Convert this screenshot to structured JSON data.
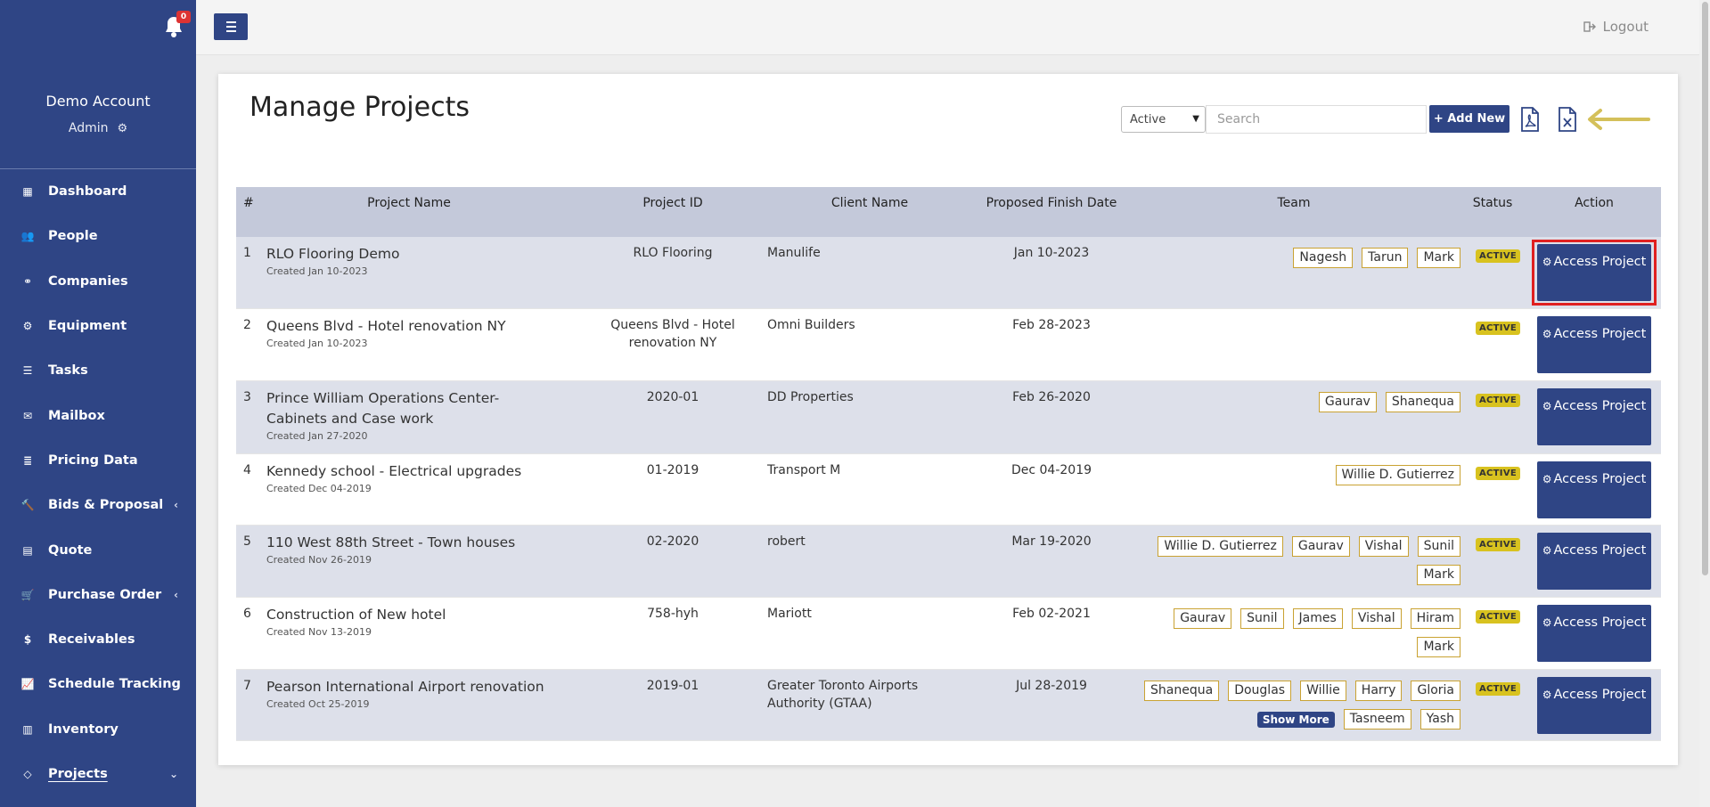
{
  "sidebar": {
    "notifications": {
      "count": "0",
      "icon": "bell-icon"
    },
    "account": {
      "name": "Demo Account",
      "role": "Admin"
    },
    "items": [
      {
        "label": "Dashboard",
        "icon": "grid-icon"
      },
      {
        "label": "People",
        "icon": "users-icon"
      },
      {
        "label": "Companies",
        "icon": "handshake-icon"
      },
      {
        "label": "Equipment",
        "icon": "cog-icon"
      },
      {
        "label": "Tasks",
        "icon": "list-icon"
      },
      {
        "label": "Mailbox",
        "icon": "envelope-icon"
      },
      {
        "label": "Pricing Data",
        "icon": "database-icon"
      },
      {
        "label": "Bids & Proposal",
        "icon": "gavel-icon",
        "chevron": "‹"
      },
      {
        "label": "Quote",
        "icon": "file-icon"
      },
      {
        "label": "Purchase Order",
        "icon": "cart-icon",
        "chevron": "‹"
      },
      {
        "label": "Receivables",
        "icon": "dollar-icon"
      },
      {
        "label": "Schedule Tracking",
        "icon": "chart-line-icon"
      },
      {
        "label": "Inventory",
        "icon": "building-icon"
      },
      {
        "label": "Projects",
        "icon": "diamond-icon",
        "chevron": "⌄",
        "active": true
      }
    ]
  },
  "topbar": {
    "logout_label": "Logout"
  },
  "main": {
    "title": "Manage Projects",
    "filter": {
      "selected": "Active"
    },
    "search": {
      "placeholder": "Search"
    },
    "add_label": "+ Add New",
    "export_icons": [
      "pdf-icon",
      "excel-icon"
    ],
    "accent_arrow_color": "#d4c05a"
  },
  "table": {
    "headers": [
      "#",
      "Project Name",
      "Project ID",
      "Client Name",
      "Proposed Finish Date",
      "Team",
      "Status",
      "Action"
    ],
    "action_label": "Access Project",
    "rows": [
      {
        "num": "1",
        "name": "RLO Flooring Demo",
        "created": "Created Jan 10-2023",
        "pid": "RLO Flooring",
        "client": "Manulife",
        "date": "Jan 10-2023",
        "team": [
          "Nagesh",
          "Tarun",
          "Mark"
        ],
        "status": "ACTIVE"
      },
      {
        "num": "2",
        "name": "Queens Blvd - Hotel renovation NY",
        "created": "Created Jan 10-2023",
        "pid": "Queens Blvd - Hotel renovation NY",
        "client": "Omni Builders",
        "date": "Feb 28-2023",
        "team": [],
        "status": "ACTIVE"
      },
      {
        "num": "3",
        "name": "Prince William Operations Center- Cabinets and Case work",
        "created": "Created Jan 27-2020",
        "pid": "2020-01",
        "client": "DD Properties",
        "date": "Feb 26-2020",
        "team": [
          "Gaurav",
          "Shanequa"
        ],
        "status": "ACTIVE"
      },
      {
        "num": "4",
        "name": "Kennedy school - Electrical upgrades",
        "created": "Created Dec 04-2019",
        "pid": "01-2019",
        "client": "Transport M",
        "date": "Dec 04-2019",
        "team": [
          "Willie D. Gutierrez"
        ],
        "status": "ACTIVE"
      },
      {
        "num": "5",
        "name": "110 West 88th Street - Town houses",
        "created": "Created Nov 26-2019",
        "pid": "02-2020",
        "client": "robert",
        "date": "Mar 19-2020",
        "team": [
          "Willie D. Gutierrez",
          "Gaurav",
          "Vishal",
          "Sunil",
          "Mark"
        ],
        "status": "ACTIVE"
      },
      {
        "num": "6",
        "name": "Construction of New hotel",
        "created": "Created Nov 13-2019",
        "pid": "758-hyh",
        "client": "Mariott",
        "date": "Feb 02-2021",
        "team": [
          "Gaurav",
          "Sunil",
          "James",
          "Vishal",
          "Hiram",
          "Mark"
        ],
        "status": "ACTIVE"
      },
      {
        "num": "7",
        "name": "Pearson International Airport renovation",
        "created": "Created Oct 25-2019",
        "pid": "2019-01",
        "client": "Greater Toronto Airports Authority (GTAA)",
        "date": "Jul 28-2019",
        "team": [
          "Shanequa",
          "Douglas",
          "Willie",
          "Harry",
          "Gloria",
          "Tasneem",
          "Yash"
        ],
        "show_more": "Show More",
        "status": "ACTIVE"
      }
    ]
  }
}
